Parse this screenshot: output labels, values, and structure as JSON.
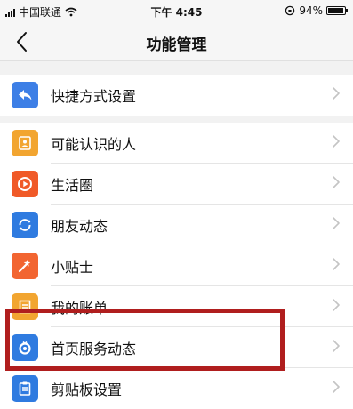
{
  "status_bar": {
    "carrier": "中国联通",
    "time": "下午 4:45",
    "battery_label": "94%",
    "battery_level": 0.94
  },
  "nav": {
    "title": "功能管理"
  },
  "groups": [
    {
      "items": [
        {
          "label": "快捷方式设置",
          "icon": "share-arrow-icon",
          "color": "#3d7fe6"
        }
      ]
    },
    {
      "items": [
        {
          "label": "可能认识的人",
          "icon": "contact-card-icon",
          "color": "#f2a530"
        },
        {
          "label": "生活圈",
          "icon": "play-circle-icon",
          "color": "#f05a28"
        },
        {
          "label": "朋友动态",
          "icon": "sync-circle-icon",
          "color": "#2f7be0"
        },
        {
          "label": "小贴士",
          "icon": "magic-wand-icon",
          "color": "#f26531"
        },
        {
          "label": "我的账单",
          "icon": "bill-icon",
          "color": "#f2a530"
        },
        {
          "label": "首页服务动态",
          "icon": "ring-icon",
          "color": "#2f7be0"
        },
        {
          "label": "剪贴板设置",
          "icon": "clipboard-icon",
          "color": "#2f7be0"
        }
      ]
    }
  ],
  "colors": {
    "highlight": "#b01e1e"
  }
}
